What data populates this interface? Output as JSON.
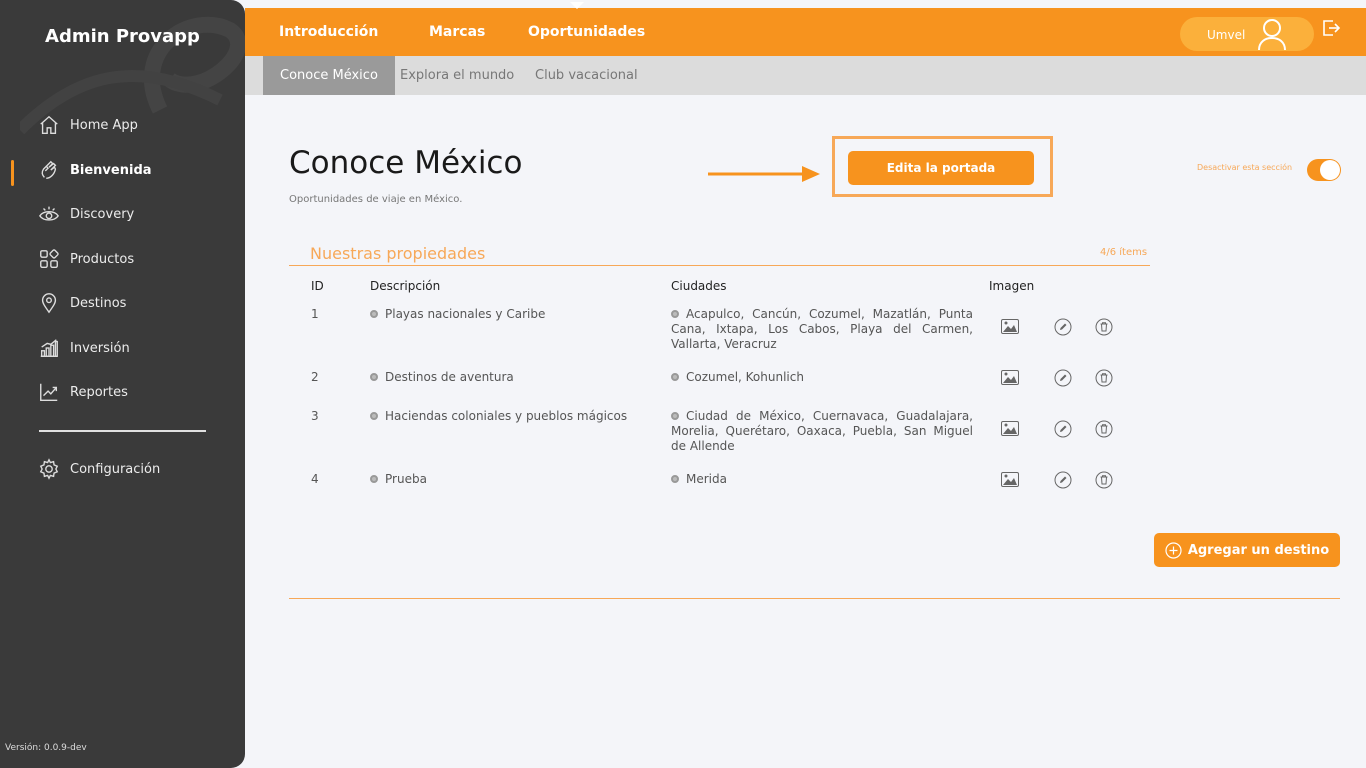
{
  "sidebar": {
    "title": "Admin Provapp",
    "items": [
      {
        "label": "Home App",
        "icon": "home-icon"
      },
      {
        "label": "Bienvenida",
        "icon": "wave-hand-icon"
      },
      {
        "label": "Discovery",
        "icon": "eye-icon"
      },
      {
        "label": "Productos",
        "icon": "grid-icon"
      },
      {
        "label": "Destinos",
        "icon": "location-pin-icon"
      },
      {
        "label": "Inversión",
        "icon": "bar-chart-icon"
      },
      {
        "label": "Reportes",
        "icon": "line-chart-icon"
      },
      {
        "label": "Configuración",
        "icon": "gear-icon"
      }
    ],
    "active": "Bienvenida",
    "version": "Versión: 0.0.9-dev"
  },
  "topnav": {
    "tabs": [
      "Introducción",
      "Marcas",
      "Oportunidades"
    ],
    "active": "Oportunidades",
    "user": "Umvel"
  },
  "subnav": {
    "tabs": [
      "Conoce México",
      "Explora el mundo",
      "Club vacacional"
    ],
    "active": "Conoce México"
  },
  "page": {
    "title": "Conoce México",
    "subtitle": "Oportunidades de viaje en México.",
    "edit_cover_label": "Edita la portada",
    "toggle_label": "Desactivar esta sección",
    "toggle_on": true
  },
  "section": {
    "title": "Nuestras propiedades",
    "count": "4/6 ítems",
    "columns": [
      "ID",
      "Descripción",
      "Ciudades",
      "Imagen"
    ],
    "rows": [
      {
        "id": "1",
        "description": "Playas nacionales y Caribe",
        "cities": "Acapulco, Cancún, Cozumel, Mazatlán, Punta Cana, Ixtapa, Los Cabos, Playa del Carmen, Vallarta, Veracruz"
      },
      {
        "id": "2",
        "description": "Destinos de aventura",
        "cities": "Cozumel, Kohunlich"
      },
      {
        "id": "3",
        "description": "Haciendas coloniales y pueblos mágicos",
        "cities": "Ciudad de México, Cuernavaca, Guadalajara, Morelia, Querétaro, Oaxaca, Puebla, San Miguel de Allende"
      },
      {
        "id": "4",
        "description": "Prueba",
        "cities": "Merida"
      }
    ],
    "add_label": "Agregar un destino"
  },
  "colors": {
    "accent": "#f7931e",
    "accent_light": "#f7a858",
    "sidebar": "#3a3a3a"
  }
}
